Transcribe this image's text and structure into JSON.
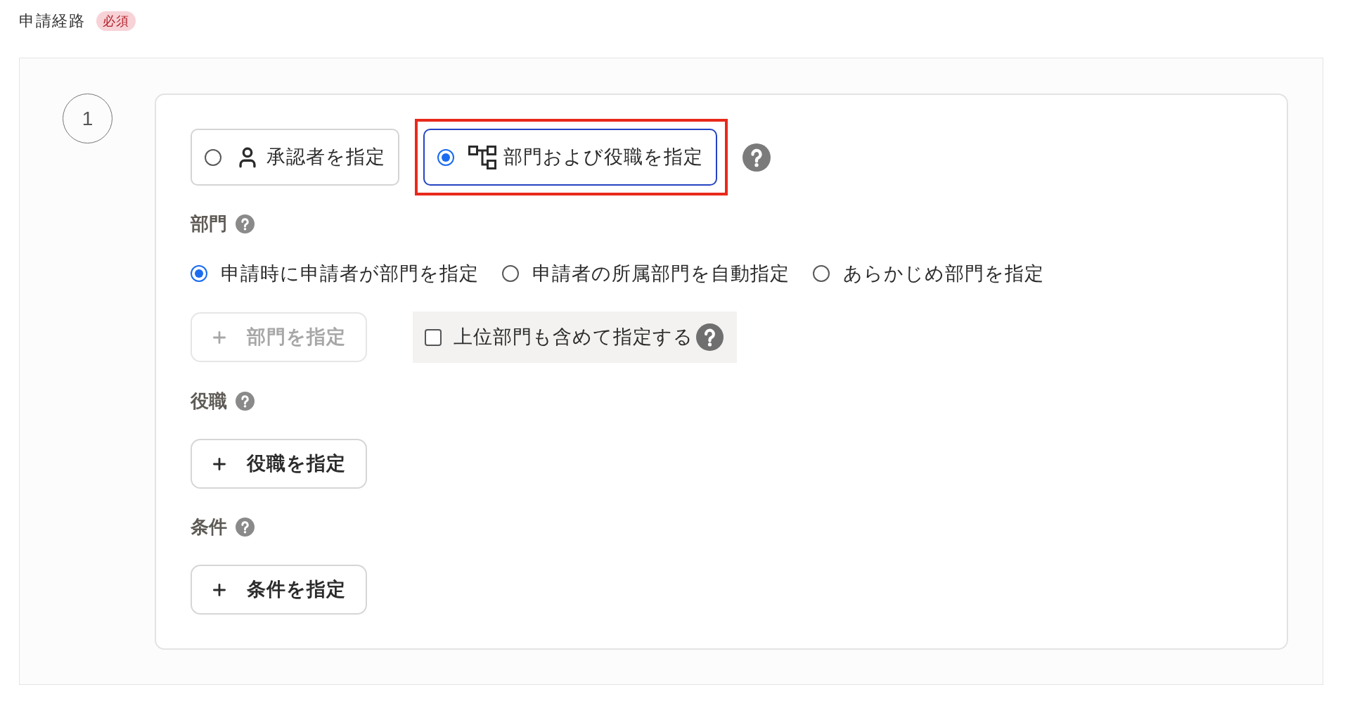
{
  "field": {
    "label": "申請経路",
    "required_badge": "必須"
  },
  "steps": [
    {
      "number": "1",
      "approver_modes": [
        {
          "kind": "person",
          "label": "承認者を指定",
          "selected": false,
          "highlighted": false
        },
        {
          "kind": "org",
          "label": "部門および役職を指定",
          "selected": true,
          "highlighted": true
        }
      ],
      "sections": [
        {
          "title": "部門",
          "options": [
            {
              "label": "申請時に申請者が部門を指定",
              "selected": true
            },
            {
              "label": "申請者の所属部門を自動指定",
              "selected": false
            },
            {
              "label": "あらかじめ部門を指定",
              "selected": false
            }
          ],
          "add_button": {
            "label": "部門を指定",
            "disabled": true
          },
          "include_parent": {
            "label": "上位部門も含めて指定する",
            "checked": false
          }
        },
        {
          "title": "役職",
          "add_button": {
            "label": "役職を指定",
            "disabled": false
          }
        },
        {
          "title": "条件",
          "add_button": {
            "label": "条件を指定",
            "disabled": false
          }
        }
      ]
    }
  ]
}
